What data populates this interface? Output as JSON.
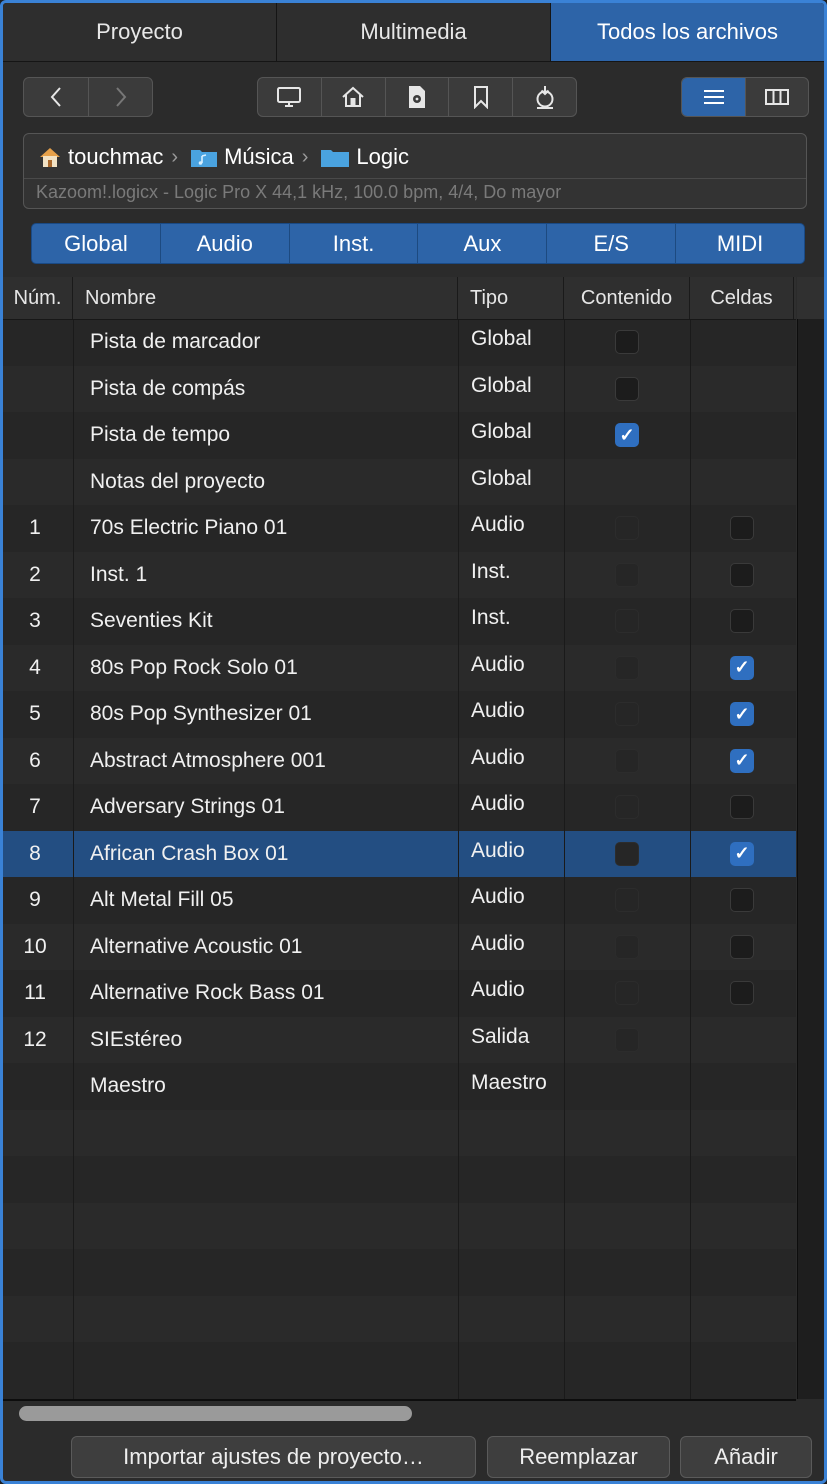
{
  "tabs": [
    {
      "label": "Proyecto"
    },
    {
      "label": "Multimedia"
    },
    {
      "label": "Todos los archivos"
    }
  ],
  "path": {
    "items": [
      "touchmac",
      "Música",
      "Logic"
    ],
    "info": "Kazoom!.logicx - Logic Pro X 44,1 kHz, 100.0 bpm, 4/4, Do mayor"
  },
  "filters": [
    "Global",
    "Audio",
    "Inst.",
    "Aux",
    "E/S",
    "MIDI"
  ],
  "columns": {
    "num": "Núm.",
    "name": "Nombre",
    "type": "Tipo",
    "content": "Contenido",
    "cells": "Celdas"
  },
  "rows": [
    {
      "num": "",
      "name": "Pista de marcador",
      "type": "Global"
    },
    {
      "num": "",
      "name": "Pista de compás",
      "type": "Global"
    },
    {
      "num": "",
      "name": "Pista de tempo",
      "type": "Global"
    },
    {
      "num": "",
      "name": "Notas del proyecto",
      "type": "Global"
    },
    {
      "num": "1",
      "name": "70s Electric Piano 01",
      "type": "Audio"
    },
    {
      "num": "2",
      "name": "Inst. 1",
      "type": "Inst."
    },
    {
      "num": "3",
      "name": "Seventies Kit",
      "type": "Inst."
    },
    {
      "num": "4",
      "name": "80s Pop Rock Solo 01",
      "type": "Audio"
    },
    {
      "num": "5",
      "name": "80s Pop Synthesizer 01",
      "type": "Audio"
    },
    {
      "num": "6",
      "name": "Abstract Atmosphere 001",
      "type": "Audio"
    },
    {
      "num": "7",
      "name": "Adversary Strings 01",
      "type": "Audio"
    },
    {
      "num": "8",
      "name": "African Crash Box 01",
      "type": "Audio"
    },
    {
      "num": "9",
      "name": "Alt Metal Fill 05",
      "type": "Audio"
    },
    {
      "num": "10",
      "name": "Alternative Acoustic 01",
      "type": "Audio"
    },
    {
      "num": "11",
      "name": "Alternative Rock Bass 01",
      "type": "Audio"
    },
    {
      "num": "12",
      "name": "SIEstéreo",
      "type": "Salida"
    },
    {
      "num": "",
      "name": "Maestro",
      "type": "Maestro"
    }
  ],
  "checkbox_states": {
    "content": [
      "off",
      "off",
      "on",
      "none",
      "dim",
      "dim",
      "dim",
      "dim",
      "dim",
      "dim",
      "dim",
      "dim",
      "dim",
      "dim",
      "dim",
      "dim",
      "none"
    ],
    "cells": [
      "none",
      "none",
      "none",
      "none",
      "off",
      "off",
      "off",
      "on",
      "on",
      "on",
      "off",
      "on",
      "off",
      "off",
      "off",
      "none",
      "none"
    ]
  },
  "selected_row_number": "8",
  "buttons": {
    "import": "Importar ajustes de proyecto…",
    "replace": "Reemplazar",
    "add": "Añadir"
  },
  "icons": [
    "chevron-left-icon",
    "chevron-right-icon",
    "computer-icon",
    "home-icon",
    "document-icon",
    "bookmark-icon",
    "recent-icon",
    "list-view-icon",
    "column-view-icon",
    "house-icon",
    "folder-icon",
    "checkmark-icon"
  ],
  "colors": {
    "accent": "#2d64a8",
    "selection": "#234e82",
    "background": "#262626",
    "folder": "#4aa3e0"
  }
}
